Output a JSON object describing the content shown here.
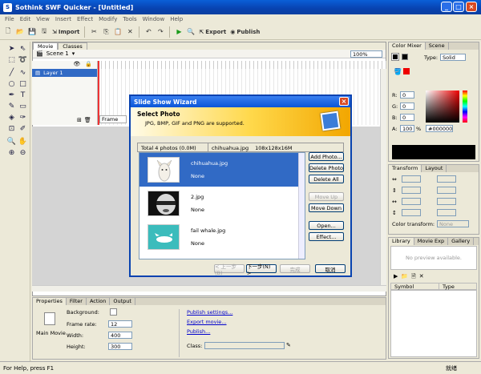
{
  "app": {
    "title": "Sothink SWF Quicker - [Untitled]"
  },
  "menu": [
    "File",
    "Edit",
    "View",
    "Insert",
    "Effect",
    "Modify",
    "Tools",
    "Window",
    "Help"
  ],
  "toolbar": {
    "import_label": "Import",
    "export_label": "Export",
    "publish_label": "Publish"
  },
  "doc": {
    "tabs": [
      "Movie",
      "Classes"
    ],
    "scene": "Scene 1",
    "zoom": "100%",
    "layer": "Layer 1",
    "frame_field": "Frame"
  },
  "dialog": {
    "title": "Slide Show Wizard",
    "heading": "Select Photo",
    "subheading": "JPG, BMP, GIF and PNG are supported.",
    "total": "Total 4 photos (0.0M)",
    "selected_info": "chihuahua.jpg",
    "selected_size": "108x128x16M",
    "photos": [
      {
        "name": "chihuahua.jpg",
        "effect": "None"
      },
      {
        "name": "2.jpg",
        "effect": "None"
      },
      {
        "name": "fail whale.jpg",
        "effect": "None"
      }
    ],
    "buttons": {
      "add": "Add Photo...",
      "delete": "Delete Photo",
      "delete_all": "Delete All",
      "move_up": "Move Up",
      "move_down": "Move Down",
      "open": "Open...",
      "effect": "Effect..."
    },
    "nav": {
      "back": "< 上一步(B)",
      "next": "下一步(N) >",
      "finish": "完成",
      "cancel": "取消"
    }
  },
  "properties": {
    "tabs": [
      "Properties",
      "Filter",
      "Action",
      "Output"
    ],
    "section": "Main Movie",
    "background_label": "Background:",
    "frame_rate_label": "Frame rate:",
    "frame_rate": "12",
    "width_label": "Width:",
    "width": "400",
    "height_label": "Height:",
    "height": "300",
    "links": [
      "Publish settings...",
      "Export movie...",
      "Publish..."
    ],
    "class_label": "Class:"
  },
  "color_mixer": {
    "tabs": [
      "Color Mixer",
      "Scene"
    ],
    "type_label": "Type:",
    "type_value": "Solid",
    "r_label": "R:",
    "r": "0",
    "g_label": "G:",
    "g": "0",
    "b_label": "B:",
    "b": "0",
    "a_label": "A:",
    "a": "100",
    "a_unit": "%",
    "hex": "#000000"
  },
  "transform": {
    "tabs": [
      "Transform",
      "Layout"
    ],
    "color_label": "Color transform:",
    "color_value": "None"
  },
  "library": {
    "tabs": [
      "Library",
      "Movie Exp",
      "Gallery"
    ],
    "preview": "No preview available.",
    "col_symbol": "Symbol",
    "col_type": "Type"
  },
  "status": {
    "text": "For Help, press F1",
    "right": "就绪"
  },
  "colors": {
    "selection": "#316ac5",
    "titlebar": "#0842b0",
    "header_gold": "#ffd84a"
  }
}
